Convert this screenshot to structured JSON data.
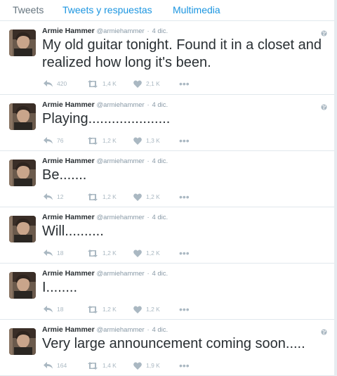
{
  "tabs": [
    {
      "label": "Tweets",
      "active": true
    },
    {
      "label": "Tweets y respuestas",
      "active": false
    },
    {
      "label": "Multimedia",
      "active": false
    }
  ],
  "tweets": [
    {
      "fullname": "Armie Hammer",
      "username": "@armiehammer",
      "time": "4 dic.",
      "text": "My old guitar tonight. Found it in a closet and realized how long it's been.",
      "replies": "420",
      "retweets": "1,4 K",
      "likes": "2,1 K",
      "globe": true
    },
    {
      "fullname": "Armie Hammer",
      "username": "@armiehammer",
      "time": "4 dic.",
      "text": "Playing.....................",
      "replies": "76",
      "retweets": "1,2 K",
      "likes": "1,3 K",
      "globe": true
    },
    {
      "fullname": "Armie Hammer",
      "username": "@armiehammer",
      "time": "4 dic.",
      "text": "Be.......",
      "replies": "12",
      "retweets": "1,2 K",
      "likes": "1,2 K",
      "globe": false
    },
    {
      "fullname": "Armie Hammer",
      "username": "@armiehammer",
      "time": "4 dic.",
      "text": "Will..........",
      "replies": "18",
      "retweets": "1,2 K",
      "likes": "1,2 K",
      "globe": false
    },
    {
      "fullname": "Armie Hammer",
      "username": "@armiehammer",
      "time": "4 dic.",
      "text": "I........",
      "replies": "18",
      "retweets": "1,2 K",
      "likes": "1,2 K",
      "globe": false
    },
    {
      "fullname": "Armie Hammer",
      "username": "@armiehammer",
      "time": "4 dic.",
      "text": "Very large announcement coming soon.....",
      "replies": "164",
      "retweets": "1,4 K",
      "likes": "1,9 K",
      "globe": true
    }
  ],
  "separator": "·",
  "more_label": "•••",
  "colors": {
    "link": "#1b95e0",
    "text": "#292f33",
    "muted": "#8899a6",
    "action": "#aab8c2",
    "border": "#e1e8ed"
  },
  "icons": {
    "reply": "reply-icon",
    "retweet": "retweet-icon",
    "like": "heart-icon",
    "more": "more-icon",
    "globe": "globe-icon"
  }
}
